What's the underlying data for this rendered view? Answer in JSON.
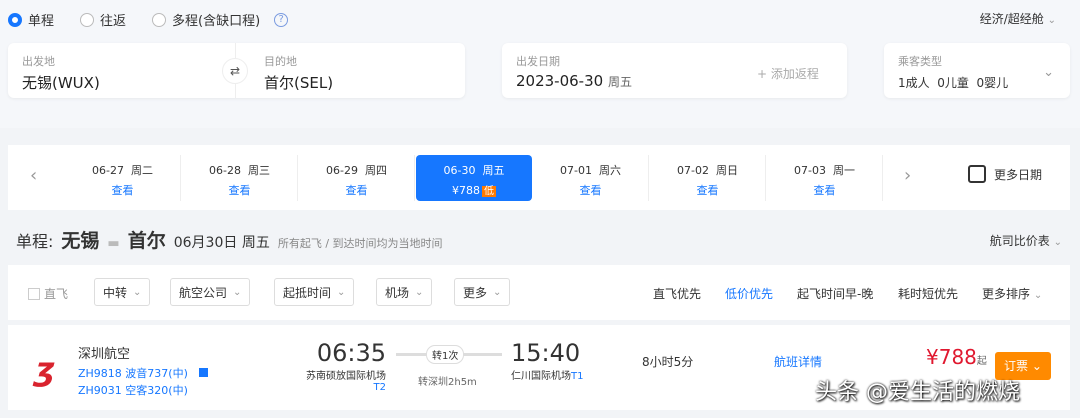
{
  "trip_types": [
    {
      "label": "单程",
      "selected": true
    },
    {
      "label": "往返",
      "selected": false
    },
    {
      "label": "多程(含缺口程)",
      "selected": false
    }
  ],
  "cabin": "经济/超经舱",
  "search": {
    "from_label": "出发地",
    "from": "无锡(WUX)",
    "to_label": "目的地",
    "to": "首尔(SEL)",
    "date_label": "出发日期",
    "date": "2023-06-30",
    "weekday": "周五",
    "add_return": "+ 添加返程",
    "pax_label": "乘客类型",
    "pax": "1成人  0儿童  0婴儿"
  },
  "dates": [
    {
      "date": "06-27",
      "wd": "周二",
      "sub": "查看"
    },
    {
      "date": "06-28",
      "wd": "周三",
      "sub": "查看"
    },
    {
      "date": "06-29",
      "wd": "周四",
      "sub": "查看"
    },
    {
      "date": "06-30",
      "wd": "周五",
      "sub": "¥788",
      "badge": "低",
      "selected": true
    },
    {
      "date": "07-01",
      "wd": "周六",
      "sub": "查看"
    },
    {
      "date": "07-02",
      "wd": "周日",
      "sub": "查看"
    },
    {
      "date": "07-03",
      "wd": "周一",
      "sub": "查看"
    }
  ],
  "more_dates": "更多日期",
  "route": {
    "prefix": "单程:",
    "from": "无锡",
    "to": "首尔",
    "date": "06月30日 周五",
    "note": "所有起飞 / 到达时间均为当地时间",
    "compare": "航司比价表"
  },
  "filters": {
    "direct": "直飞",
    "buttons": [
      "中转",
      "航空公司",
      "起抵时间",
      "机场",
      "更多"
    ],
    "sorts": [
      "直飞优先",
      "低价优先",
      "起飞时间早-晚",
      "耗时短优先",
      "更多排序"
    ]
  },
  "flight": {
    "airline": "深圳航空",
    "legs": [
      "ZH9818 波音737(中)",
      "ZH9031 空客320(中)"
    ],
    "dep_time": "06:35",
    "dep_airport": "苏南硕放国际机场",
    "dep_terminal": "T2",
    "stops": "转1次",
    "transfer": "转深圳2h5m",
    "arr_time": "15:40",
    "arr_airport": "仁川国际机场",
    "arr_terminal": "T1",
    "duration": "8小时5分",
    "details": "航班详情",
    "price": "¥788",
    "price_suffix": "起",
    "book": "订票"
  },
  "watermark": "头条 @爱生活的燃烧",
  "colors": {
    "accent": "#1677ff",
    "price": "#e0182f",
    "book": "#ff8a00"
  }
}
